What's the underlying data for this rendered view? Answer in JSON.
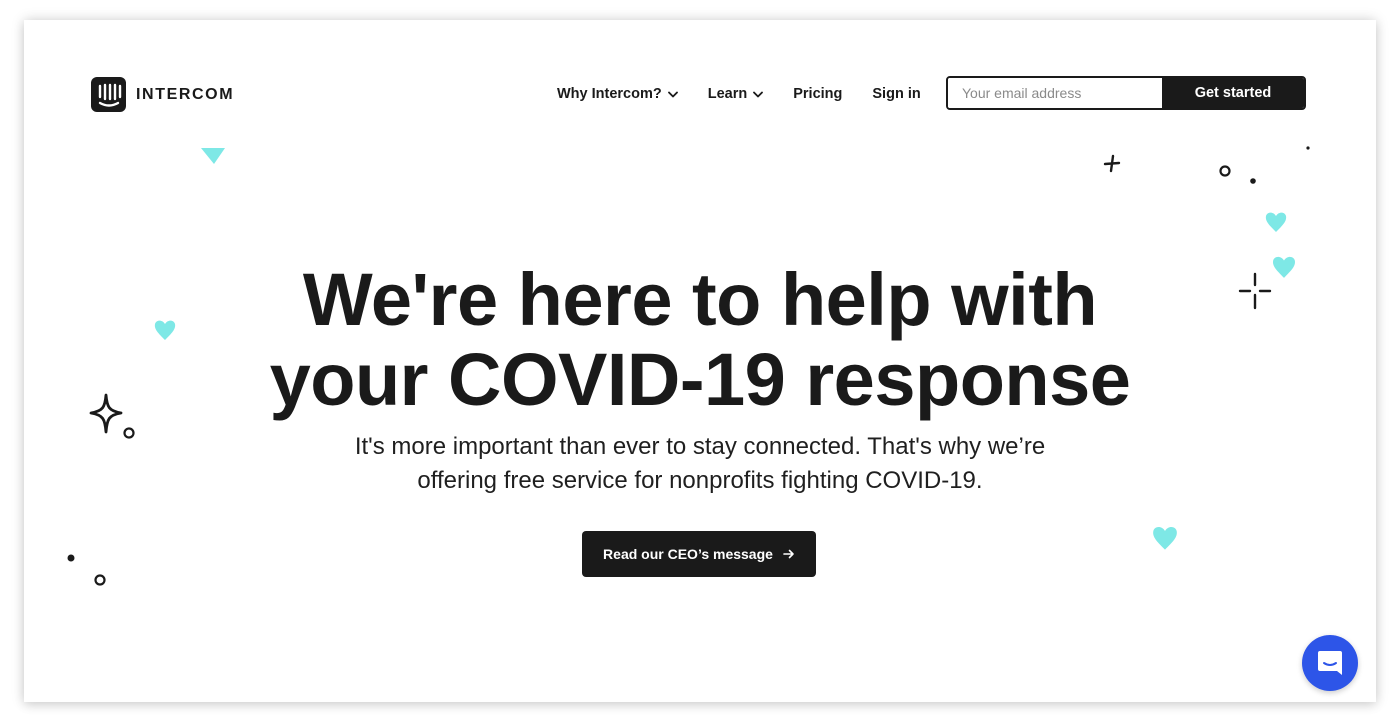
{
  "brand": {
    "name": "INTERCOM",
    "logo_icon": "intercom-logo-icon"
  },
  "nav": {
    "items": [
      {
        "label": "Why Intercom?",
        "has_dropdown": true
      },
      {
        "label": "Learn",
        "has_dropdown": true
      },
      {
        "label": "Pricing",
        "has_dropdown": false
      },
      {
        "label": "Sign in",
        "has_dropdown": false
      }
    ]
  },
  "signup": {
    "email_placeholder": "Your email address",
    "email_value": "",
    "button_label": "Get started"
  },
  "hero": {
    "title_lines": [
      "We're here to help with",
      "your COVID-19 response"
    ],
    "subtitle_lines": [
      "It's more important than ever to stay connected. That's why we’re",
      "offering free service for nonprofits fighting COVID-19."
    ],
    "cta_label": "Read our CEO’s message",
    "cta_icon": "arrow-right-icon"
  },
  "messenger": {
    "icon": "chat-bubble-icon"
  },
  "colors": {
    "text": "#1a1a1a",
    "heart": "#7ee8e6",
    "messenger": "#2d55e8"
  }
}
